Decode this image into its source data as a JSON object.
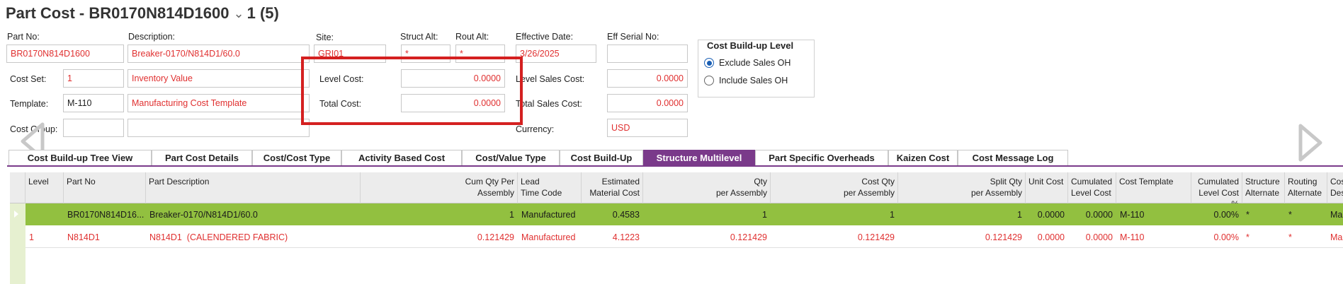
{
  "header": {
    "title": "Part Cost - BR0170N814D1600",
    "record_counter": "1 (5)"
  },
  "form": {
    "part_no": {
      "label": "Part No:",
      "value": "BR0170N814D1600"
    },
    "description": {
      "label": "Description:",
      "value": "Breaker-0170/N814D1/60.0"
    },
    "site": {
      "label": "Site:",
      "value": "GRI01"
    },
    "struct_alt": {
      "label": "Struct Alt:",
      "value": "*"
    },
    "rout_alt": {
      "label": "Rout Alt:",
      "value": "*"
    },
    "effective_date": {
      "label": "Effective Date:",
      "value": "3/26/2025"
    },
    "eff_serial_no": {
      "label": "Eff Serial No:",
      "value": ""
    },
    "cost_set": {
      "label": "Cost Set:",
      "value": "1",
      "description": "Inventory Value"
    },
    "template": {
      "label": "Template:",
      "value": "M-110",
      "description": "Manufacturing Cost Template"
    },
    "cost_group": {
      "label": "Cost Group:",
      "value": "",
      "description": ""
    },
    "level_cost": {
      "label": "Level Cost:",
      "value": "0.0000"
    },
    "total_cost": {
      "label": "Total Cost:",
      "value": "0.0000"
    },
    "level_sales_cost": {
      "label": "Level Sales Cost:",
      "value": "0.0000"
    },
    "total_sales_cost": {
      "label": "Total Sales Cost:",
      "value": "0.0000"
    },
    "currency": {
      "label": "Currency:",
      "value": "USD"
    }
  },
  "cost_buildup_level": {
    "title": "Cost Build-up Level",
    "options": [
      "Exclude Sales OH",
      "Include Sales OH"
    ],
    "selected": "Exclude Sales OH"
  },
  "tabs": [
    {
      "label": "Cost Build-up Tree View"
    },
    {
      "label": "Part Cost Details"
    },
    {
      "label": "Cost/Cost Type"
    },
    {
      "label": "Activity Based Cost"
    },
    {
      "label": "Cost/Value Type"
    },
    {
      "label": "Cost Build-Up"
    },
    {
      "label": "Structure Multilevel",
      "active": true
    },
    {
      "label": "Part Specific Overheads"
    },
    {
      "label": "Kaizen Cost"
    },
    {
      "label": "Cost Message Log"
    }
  ],
  "grid": {
    "columns": [
      "Level",
      "Part No",
      "Part Description",
      "Cum Qty Per\nAssembly",
      "Lead\nTime Code",
      "Estimated\nMaterial Cost",
      "Qty\nper Assembly",
      "Cost Qty\nper Assembly",
      "Split Qty\nper Assembly",
      "Unit Cost",
      "Cumulated\nLevel Cost",
      "Cost Template",
      "Cumulated\nLevel Cost %",
      "Structure\nAlternate",
      "Routing\nAlternate",
      "Cost\nDesc"
    ],
    "rows": [
      {
        "level": "",
        "part_no": "BR0170N814D16...",
        "part_description": "Breaker-0170/N814D1/60.0",
        "cum_qty": "1",
        "lead_time_code": "Manufactured",
        "est_material_cost": "0.4583",
        "qty_per_assembly": "1",
        "cost_qty_per_assembly": "1",
        "split_qty_per_assembly": "1",
        "unit_cost": "0.0000",
        "cumulated_level_cost": "0.0000",
        "cost_template": "M-110",
        "cumulated_level_cost_pct": "0.00%",
        "structure_alternate": "*",
        "routing_alternate": "*",
        "cost_desc": "Manu"
      },
      {
        "level": "1",
        "part_no": "N814D1",
        "part_description": "N814D1  (CALENDERED FABRIC)",
        "cum_qty": "0.121429",
        "lead_time_code": "Manufactured",
        "est_material_cost": "4.1223",
        "qty_per_assembly": "0.121429",
        "cost_qty_per_assembly": "0.121429",
        "split_qty_per_assembly": "0.121429",
        "unit_cost": "0.0000",
        "cumulated_level_cost": "0.0000",
        "cost_template": "M-110",
        "cumulated_level_cost_pct": "0.00%",
        "structure_alternate": "*",
        "routing_alternate": "*",
        "cost_desc": "Manu"
      }
    ]
  },
  "colors": {
    "accent": "#7a3a8a",
    "selected_row": "#92c040",
    "value_red": "#e03030",
    "highlight_box": "#d42020"
  }
}
